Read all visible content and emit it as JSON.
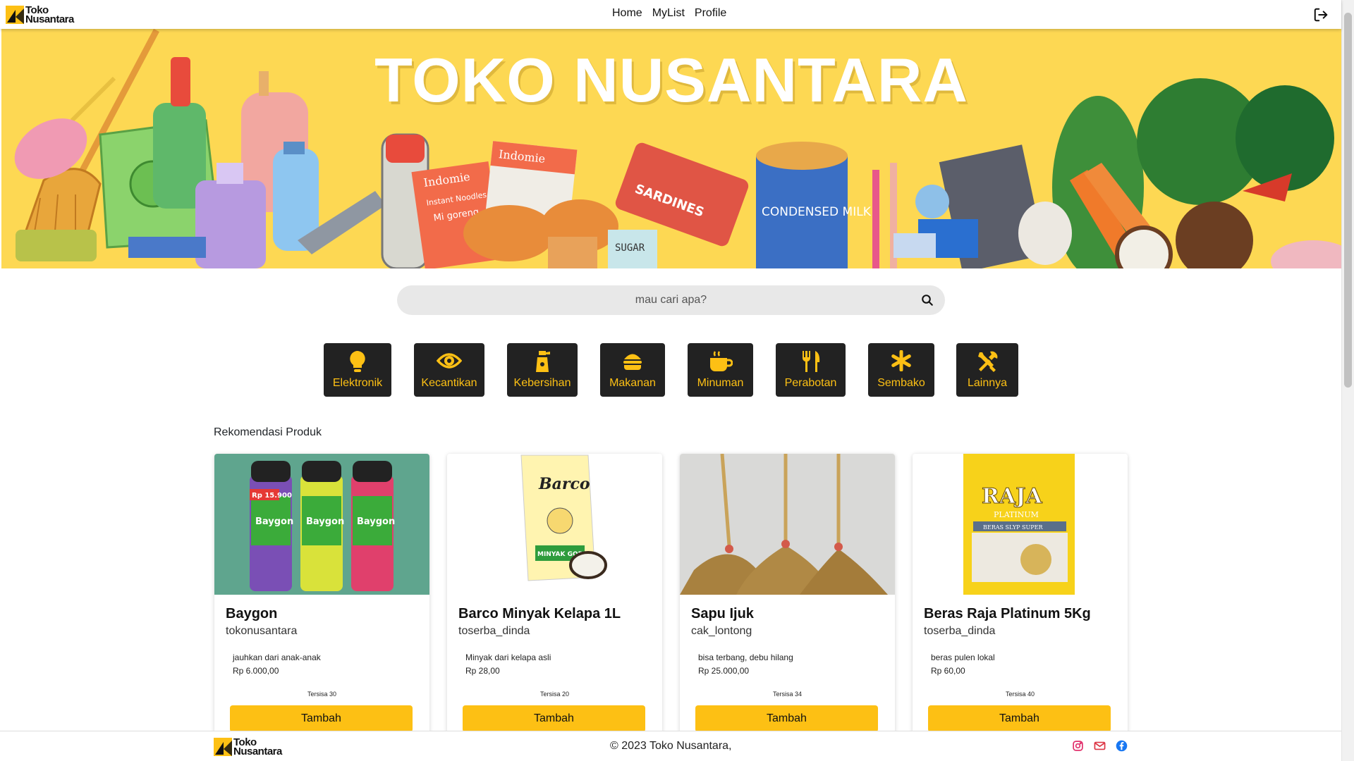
{
  "brand": {
    "line1": "Toko",
    "line2": "Nusantara"
  },
  "nav": {
    "home": "Home",
    "mylist": "MyList",
    "profile": "Profile"
  },
  "hero": {
    "title": "TOKO NUSANTARA",
    "art_labels": [
      "Indomie",
      "Indomie",
      "Instant Noodles",
      "Mi goreng",
      "SARDINES",
      "CONDENSED MILK",
      "SUGAR"
    ]
  },
  "search": {
    "placeholder": "mau cari apa?"
  },
  "categories": [
    {
      "label": "Elektronik",
      "icon": "lightbulb-icon"
    },
    {
      "label": "Kecantikan",
      "icon": "eye-icon"
    },
    {
      "label": "Kebersihan",
      "icon": "spray-bottle-icon"
    },
    {
      "label": "Makanan",
      "icon": "burger-icon"
    },
    {
      "label": "Minuman",
      "icon": "mug-icon"
    },
    {
      "label": "Perabotan",
      "icon": "utensils-icon"
    },
    {
      "label": "Sembako",
      "icon": "asterisk-icon"
    },
    {
      "label": "Lainnya",
      "icon": "tools-icon"
    }
  ],
  "section_title": "Rekomendasi Produk",
  "products": [
    {
      "name": "Baygon",
      "seller": "tokonusantara",
      "description": "jauhkan dari anak-anak",
      "price": "Rp 6.000,00",
      "stock": "Tersisa 30",
      "button": "Tambah",
      "image_labels": [
        "Baygon",
        "Baygon",
        "Baygon",
        "Rp 15.900"
      ]
    },
    {
      "name": "Barco Minyak Kelapa 1L",
      "seller": "toserba_dinda",
      "description": "Minyak dari kelapa asli",
      "price": "Rp 28,00",
      "stock": "Tersisa 20",
      "button": "Tambah",
      "image_labels": [
        "Barco",
        "MINYAK GORENG"
      ]
    },
    {
      "name": "Sapu Ijuk",
      "seller": "cak_lontong",
      "description": "bisa terbang, debu hilang",
      "price": "Rp 25.000,00",
      "stock": "Tersisa 34",
      "button": "Tambah",
      "image_labels": []
    },
    {
      "name": "Beras Raja Platinum 5Kg",
      "seller": "toserba_dinda",
      "description": "beras pulen lokal",
      "price": "Rp 60,00",
      "stock": "Tersisa 40",
      "button": "Tambah",
      "image_labels": [
        "RAJA",
        "PLATINUM",
        "BERAS SLYP SUPER"
      ]
    }
  ],
  "footer": {
    "copyright": "© 2023 Toko Nusantara,"
  },
  "colors": {
    "accent": "#fdc014",
    "hero_bg": "#fdd853",
    "category_bg": "#222222",
    "instagram": "#e1306c",
    "email": "#dc3545",
    "facebook": "#1877f2"
  }
}
